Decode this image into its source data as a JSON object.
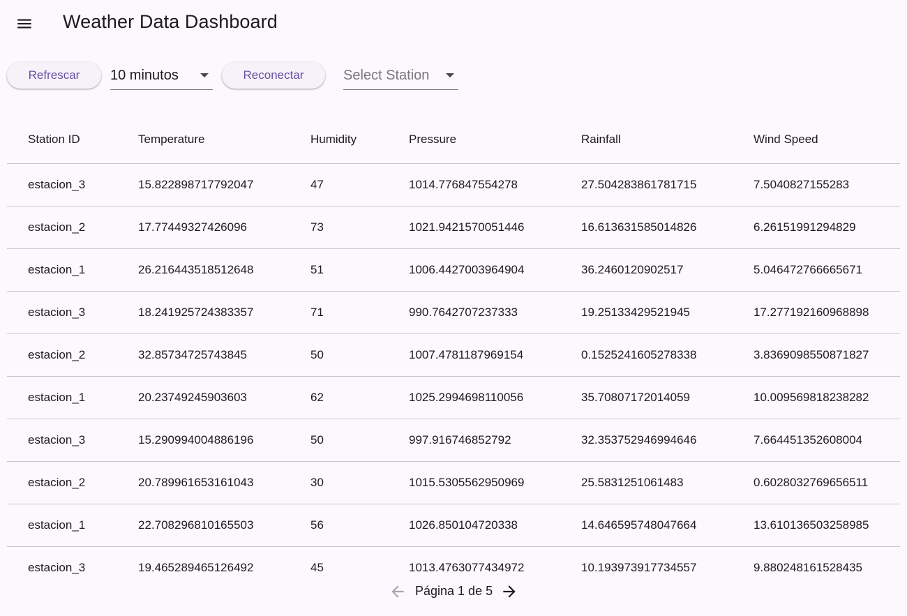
{
  "appbar": {
    "title": "Weather Data Dashboard",
    "menu_icon": "menu-icon"
  },
  "toolbar": {
    "refresh_label": "Refrescar",
    "interval_value": "10 minutos",
    "reconnect_label": "Reconectar",
    "station_placeholder": "Select Station"
  },
  "table": {
    "columns": [
      "Station ID",
      "Temperature",
      "Humidity",
      "Pressure",
      "Rainfall",
      "Wind Speed"
    ],
    "rows": [
      [
        "estacion_3",
        "15.822898717792047",
        "47",
        "1014.776847554278",
        "27.504283861781715",
        "7.5040827155283"
      ],
      [
        "estacion_2",
        "17.77449327426096",
        "73",
        "1021.9421570051446",
        "16.613631585014826",
        "6.26151991294829"
      ],
      [
        "estacion_1",
        "26.216443518512648",
        "51",
        "1006.4427003964904",
        "36.2460120902517",
        "5.046472766665671"
      ],
      [
        "estacion_3",
        "18.241925724383357",
        "71",
        "990.7642707237333",
        "19.25133429521945",
        "17.277192160968898"
      ],
      [
        "estacion_2",
        "32.85734725743845",
        "50",
        "1007.4781187969154",
        "0.1525241605278338",
        "3.8369098550871827"
      ],
      [
        "estacion_1",
        "20.23749245903603",
        "62",
        "1025.2994698110056",
        "35.70807172014059",
        "10.009569818238282"
      ],
      [
        "estacion_3",
        "15.290994004886196",
        "50",
        "997.916746852792",
        "32.353752946994646",
        "7.664451352608004"
      ],
      [
        "estacion_2",
        "20.789961653161043",
        "30",
        "1015.5305562950969",
        "25.5831251061483",
        "0.6028032769656511"
      ],
      [
        "estacion_1",
        "22.708296810165503",
        "56",
        "1026.850104720338",
        "14.646595748047664",
        "13.610136503258985"
      ],
      [
        "estacion_3",
        "19.465289465126492",
        "45",
        "1013.4763077434972",
        "10.193973917734557",
        "9.880248161528435"
      ]
    ]
  },
  "pagination": {
    "label": "Página 1 de 5",
    "prev_icon": "arrow-left-icon",
    "next_icon": "arrow-right-icon"
  },
  "colors": {
    "background": "#fdf7fe",
    "accent": "#6750a4",
    "divider": "#cac4d0"
  }
}
